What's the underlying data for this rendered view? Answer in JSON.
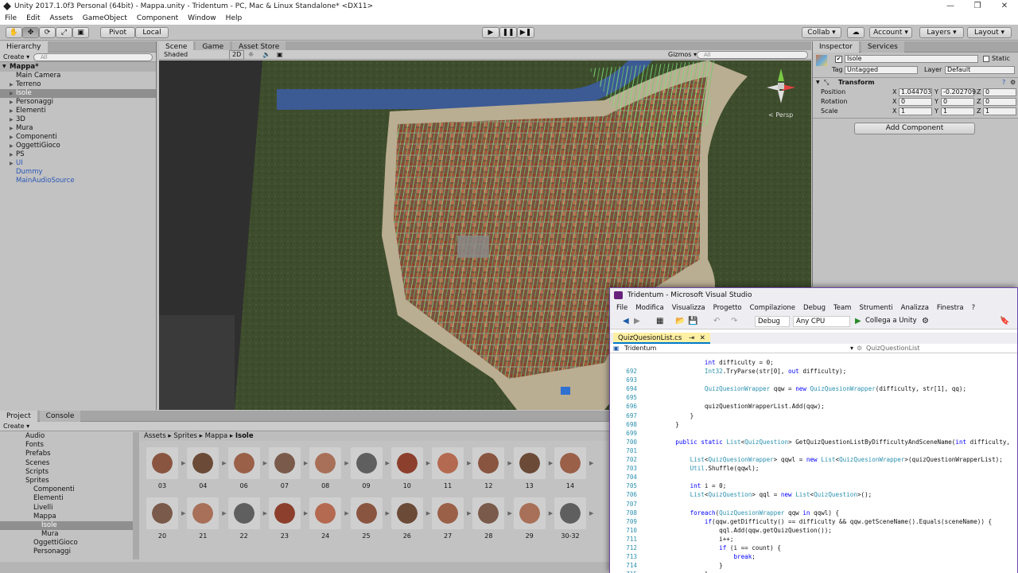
{
  "window": {
    "title": "Unity 2017.1.0f3 Personal (64bit) - Mappa.unity - Tridentum - PC, Mac & Linux Standalone* <DX11>"
  },
  "menu": [
    "File",
    "Edit",
    "Assets",
    "GameObject",
    "Component",
    "Window",
    "Help"
  ],
  "toolbar": {
    "pivot": "Pivot",
    "local": "Local",
    "collab": "Collab ▾",
    "account": "Account",
    "layers": "Layers",
    "layout": "Layout"
  },
  "hierarchy": {
    "tab": "Hierarchy",
    "create": "Create ▾",
    "search_placeholder": "All",
    "scene": "Mappa*",
    "items": [
      {
        "label": "Main Camera",
        "child": false,
        "sel": false,
        "blue": false
      },
      {
        "label": "Terreno",
        "child": true,
        "sel": false,
        "blue": false
      },
      {
        "label": "Isole",
        "child": true,
        "sel": true,
        "blue": false
      },
      {
        "label": "Personaggi",
        "child": true,
        "sel": false,
        "blue": false
      },
      {
        "label": "Elementi",
        "child": true,
        "sel": false,
        "blue": false
      },
      {
        "label": "3D",
        "child": true,
        "sel": false,
        "blue": false
      },
      {
        "label": "Mura",
        "child": true,
        "sel": false,
        "blue": false
      },
      {
        "label": "Componenti",
        "child": true,
        "sel": false,
        "blue": false
      },
      {
        "label": "OggettiGioco",
        "child": true,
        "sel": false,
        "blue": false
      },
      {
        "label": "PS",
        "child": true,
        "sel": false,
        "blue": false
      },
      {
        "label": "UI",
        "child": true,
        "sel": false,
        "blue": true
      },
      {
        "label": "Dummy",
        "child": false,
        "sel": false,
        "blue": true
      },
      {
        "label": "MainAudioSource",
        "child": false,
        "sel": false,
        "blue": true
      }
    ]
  },
  "scene": {
    "tabs": [
      "Scene",
      "Game",
      "Asset Store"
    ],
    "shading": "Shaded",
    "mode2d": "2D",
    "gizmos": "Gizmos ▾",
    "search_placeholder": "All",
    "persp": "< Persp"
  },
  "inspector": {
    "tabs": [
      "Inspector",
      "Services"
    ],
    "object_name": "Isole",
    "static_label": "Static",
    "tag_label": "Tag",
    "tag": "Untagged",
    "layer_label": "Layer",
    "layer": "Default",
    "component": "Transform",
    "rows": [
      {
        "label": "Position",
        "x": "1.044703",
        "y": "-0.202709",
        "z": "0"
      },
      {
        "label": "Rotation",
        "x": "0",
        "y": "0",
        "z": "0"
      },
      {
        "label": "Scale",
        "x": "1",
        "y": "1",
        "z": "1"
      }
    ],
    "add_component": "Add Component"
  },
  "project": {
    "tabs": [
      "Project",
      "Console"
    ],
    "create": "Create ▾",
    "folders": [
      {
        "label": "Audio",
        "level": 1
      },
      {
        "label": "Fonts",
        "level": 1
      },
      {
        "label": "Prefabs",
        "level": 1
      },
      {
        "label": "Scenes",
        "level": 1
      },
      {
        "label": "Scripts",
        "level": 1
      },
      {
        "label": "Sprites",
        "level": 1
      },
      {
        "label": "Componenti",
        "level": 2
      },
      {
        "label": "Elementi",
        "level": 2
      },
      {
        "label": "Livelli",
        "level": 2
      },
      {
        "label": "Mappa",
        "level": 2
      },
      {
        "label": "Isole",
        "level": 3
      },
      {
        "label": "Mura",
        "level": 3
      },
      {
        "label": "OggettiGioco",
        "level": 2
      },
      {
        "label": "Personaggi",
        "level": 2
      }
    ],
    "breadcrumb": [
      "Assets",
      "Sprites",
      "Mappa",
      "Isole"
    ],
    "row1": [
      "03",
      "04",
      "06",
      "07",
      "08",
      "09",
      "10",
      "11",
      "12",
      "13",
      "14"
    ],
    "row2": [
      "20",
      "21",
      "22",
      "23",
      "24",
      "25",
      "26",
      "27",
      "28",
      "29",
      "30-32"
    ]
  },
  "vs": {
    "title": "Tridentum - Microsoft Visual Studio",
    "menu": [
      "File",
      "Modifica",
      "Visualizza",
      "Progetto",
      "Compilazione",
      "Debug",
      "Team",
      "Strumenti",
      "Analizza",
      "Finestra",
      "?"
    ],
    "config": "Debug",
    "platform": "Any CPU",
    "attach": "Collega a Unity",
    "doc_tab": "QuizQuesionList.cs",
    "nav_left": "Tridentum",
    "nav_right": "QuizQuestionList",
    "code": [
      {
        "n": "",
        "t": "            int difficulty = 0;"
      },
      {
        "n": "692",
        "t": "            Int32.TryParse(str[0], out difficulty);"
      },
      {
        "n": "693",
        "t": ""
      },
      {
        "n": "694",
        "t": "            QuizQuesionWrapper qqw = new QuizQuesionWrapper(difficulty, str[1], qq);"
      },
      {
        "n": "695",
        "t": ""
      },
      {
        "n": "696",
        "t": "            quizQuestionWrapperList.Add(qqw);"
      },
      {
        "n": "697",
        "t": "        }"
      },
      {
        "n": "698",
        "t": "    }"
      },
      {
        "n": "699",
        "t": ""
      },
      {
        "n": "700",
        "t": "    public static List<QuizQuestion> GetQuizQuestionListByDifficultyAndSceneName(int difficulty,"
      },
      {
        "n": "701",
        "t": ""
      },
      {
        "n": "702",
        "t": "        List<QuizQuesionWrapper> qqwl = new List<QuizQuesionWrapper>(quizQuestionWrapperList);"
      },
      {
        "n": "703",
        "t": "        Util.Shuffle(qqwl);"
      },
      {
        "n": "704",
        "t": ""
      },
      {
        "n": "705",
        "t": "        int i = 0;"
      },
      {
        "n": "706",
        "t": "        List<QuizQuestion> qql = new List<QuizQuestion>();"
      },
      {
        "n": "707",
        "t": ""
      },
      {
        "n": "708",
        "t": "        foreach(QuizQuesionWrapper qqw in qqwl) {"
      },
      {
        "n": "709",
        "t": "            if(qqw.getDifficulty() == difficulty && qqw.getSceneName().Equals(sceneName)) {"
      },
      {
        "n": "710",
        "t": "                qql.Add(qqw.getQuizQuestion());"
      },
      {
        "n": "711",
        "t": "                i++;"
      },
      {
        "n": "712",
        "t": "                if (i == count) {"
      },
      {
        "n": "713",
        "t": "                    break;"
      },
      {
        "n": "714",
        "t": "                }"
      },
      {
        "n": "715",
        "t": "            }"
      }
    ]
  }
}
